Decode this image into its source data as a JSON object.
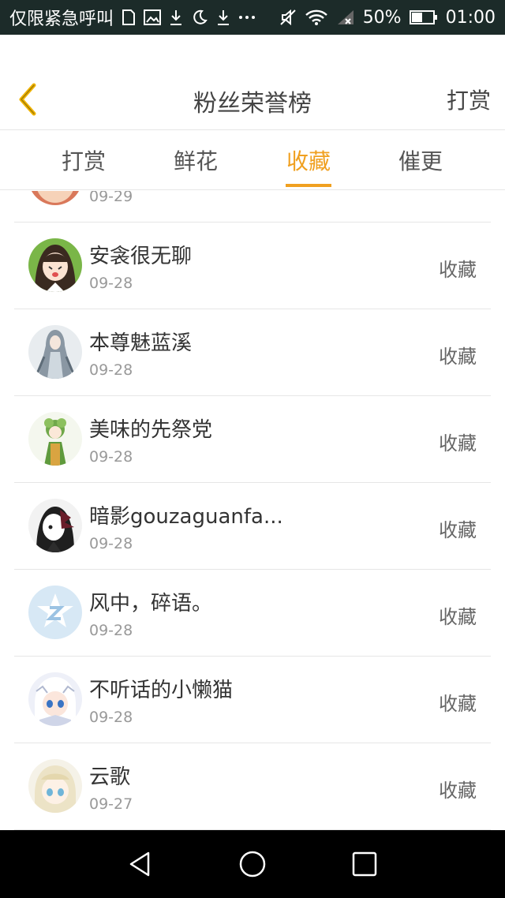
{
  "status_bar": {
    "left_text": "仅限紧急呼叫",
    "battery": "50%",
    "time": "01:00"
  },
  "header": {
    "title": "粉丝荣誉榜",
    "action_label": "打赏"
  },
  "tabs": [
    {
      "label": "打赏"
    },
    {
      "label": "鲜花"
    },
    {
      "label": "收藏"
    },
    {
      "label": "催更"
    }
  ],
  "active_tab_index": 2,
  "list": {
    "items": [
      {
        "name": "",
        "date": "09-29",
        "action": ""
      },
      {
        "name": "安衾很无聊",
        "date": "09-28",
        "action": "收藏"
      },
      {
        "name": "本尊魅蓝溪",
        "date": "09-28",
        "action": "收藏"
      },
      {
        "name": "美味的先祭党",
        "date": "09-28",
        "action": "收藏"
      },
      {
        "name": "暗影gouzaguanfa...",
        "date": "09-28",
        "action": "收藏"
      },
      {
        "name": "风中，碎语。",
        "date": "09-28",
        "action": "收藏"
      },
      {
        "name": "不听话的小懒猫",
        "date": "09-28",
        "action": "收藏"
      },
      {
        "name": "云歌",
        "date": "09-27",
        "action": "收藏"
      }
    ]
  },
  "colors": {
    "accent": "#f0a020",
    "status_bar_bg": "#1c2b29"
  }
}
